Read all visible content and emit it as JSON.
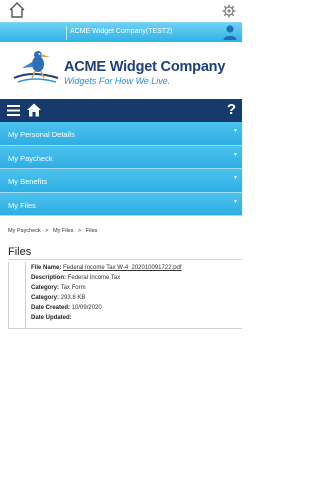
{
  "company": {
    "name": "ACME Widget Company(TEST2)"
  },
  "logo": {
    "title": "ACME Widget Company",
    "tagline": "Widgets For How We Live."
  },
  "nav": {
    "help_label": "?"
  },
  "accordion": {
    "items": [
      {
        "label": "My Personal Details"
      },
      {
        "label": "My Paycheck"
      },
      {
        "label": "My Benefits"
      },
      {
        "label": "My Files"
      }
    ],
    "caret": "▼"
  },
  "breadcrumb": {
    "items": [
      "My Paycheck",
      "My Files",
      "Files"
    ],
    "separator": ">"
  },
  "page": {
    "title": "Files"
  },
  "file": {
    "file_name_label": "File Name:",
    "file_name": "Federal Income Tax W-4_202010091722.pdf",
    "description_label": "Description:",
    "description": "Federal Income Tax",
    "category_label_1": "Category:",
    "category_1": "Tax Form",
    "category_label_2": "Category:",
    "category_2": "293.8 KB",
    "date_created_label": "Date Created:",
    "date_created": "10/09/2020",
    "date_updated_label": "Date Updated:",
    "date_updated": ""
  },
  "colors": {
    "accent": "#2eb2e6",
    "nav": "#163a6b",
    "brand_text": "#1f3f7a"
  },
  "icons": [
    "home-icon",
    "gear-icon",
    "user-icon",
    "menu-icon",
    "help-icon",
    "caret-down-icon"
  ]
}
